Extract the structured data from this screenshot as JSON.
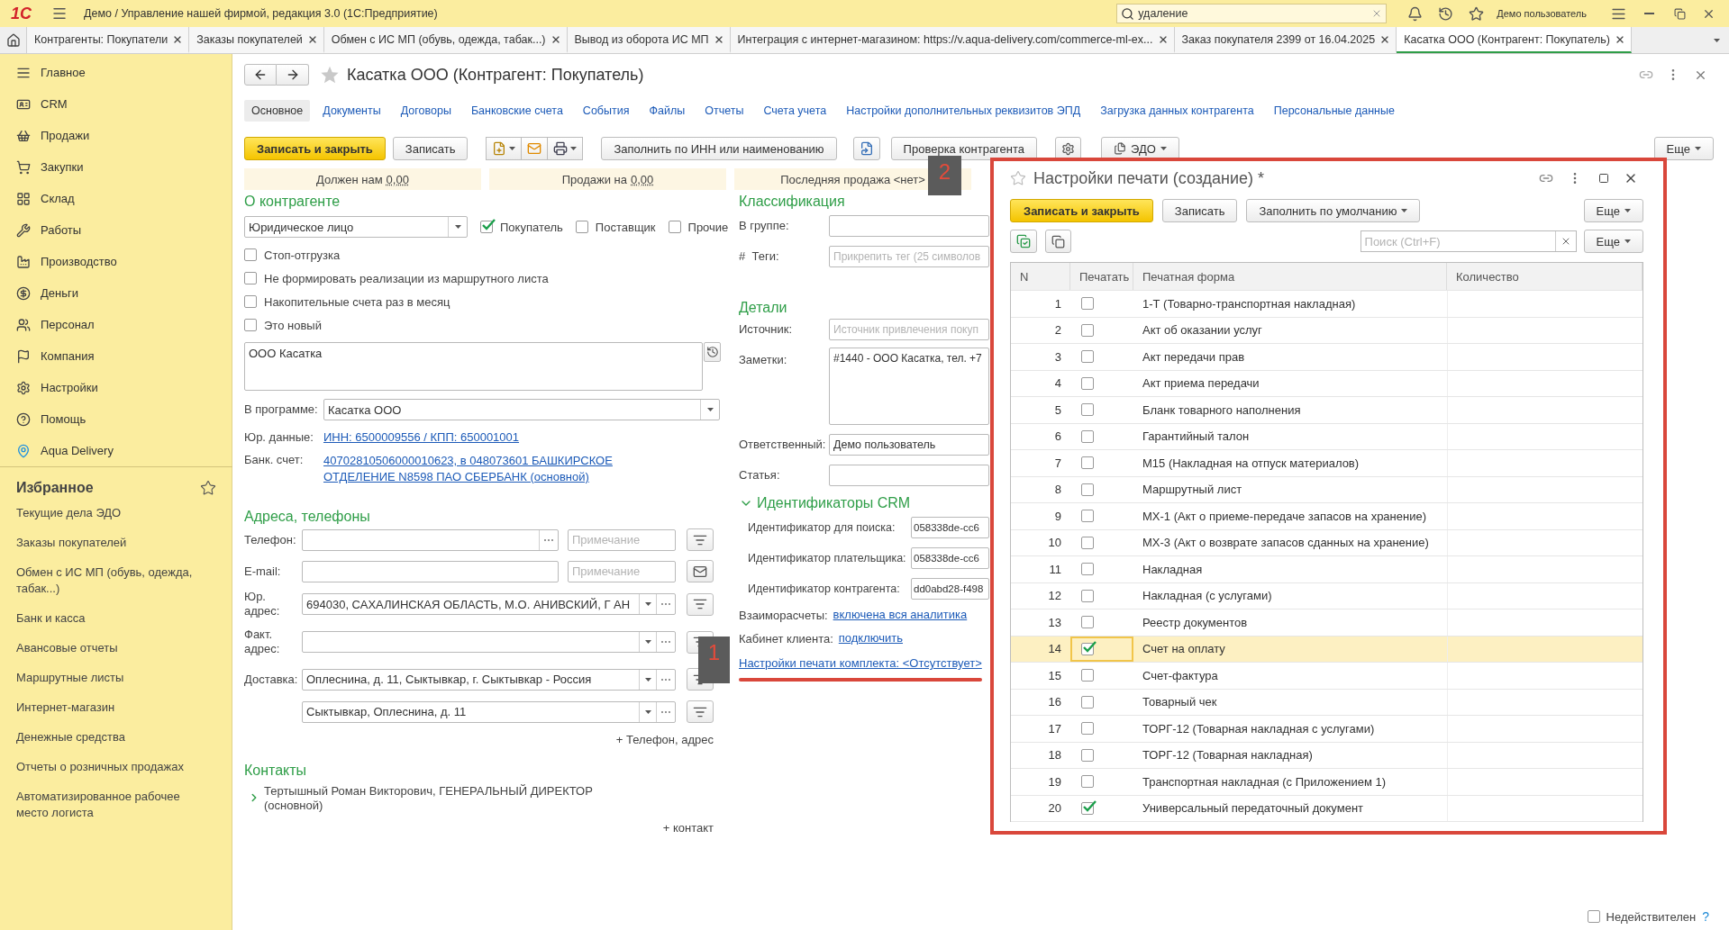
{
  "window": {
    "logo": "1С",
    "title": "Демо / Управление нашей фирмой, редакция 3.0  (1С:Предприятие)",
    "search": {
      "value": "удаление"
    },
    "user": "Демо пользователь"
  },
  "open_tabs": [
    {
      "label": "Контрагенты: Покупатели",
      "selected": false
    },
    {
      "label": "Заказы покупателей",
      "selected": false
    },
    {
      "label": "Обмен с ИС МП (обувь, одежда, табак...)",
      "selected": false
    },
    {
      "label": "Вывод из оборота ИС МП",
      "selected": false
    },
    {
      "label": "Интеграция с интернет-магазином: https://v.aqua-delivery.com/commerce-ml-ex...",
      "selected": false
    },
    {
      "label": "Заказ покупателя 2399 от 16.04.2025",
      "selected": false
    },
    {
      "label": "Касатка ООО (Контрагент: Покупатель)",
      "selected": true
    }
  ],
  "sidebar": {
    "sections": [
      {
        "label": "Главное"
      },
      {
        "label": "CRM"
      },
      {
        "label": "Продажи"
      },
      {
        "label": "Закупки"
      },
      {
        "label": "Склад"
      },
      {
        "label": "Работы"
      },
      {
        "label": "Производство"
      },
      {
        "label": "Деньги"
      },
      {
        "label": "Персонал"
      },
      {
        "label": "Компания"
      },
      {
        "label": "Настройки"
      },
      {
        "label": "Помощь"
      },
      {
        "label": "Aqua Delivery"
      }
    ],
    "favorites_title": "Избранное",
    "favorites": [
      "Текущие дела ЭДО",
      "Заказы покупателей",
      "Обмен с ИС МП (обувь, одежда, табак...)",
      "Банк и касса",
      "Авансовые отчеты",
      "Маршрутные листы",
      "Интернет-магазин",
      "Денежные средства",
      "Отчеты о розничных продажах",
      "Автоматизированное рабочее место логиста"
    ]
  },
  "form": {
    "title": "Касатка ООО (Контрагент: Покупатель)",
    "tabs": [
      {
        "label": "Основное",
        "selected": true
      },
      {
        "label": "Документы",
        "selected": false
      },
      {
        "label": "Договоры",
        "selected": false
      },
      {
        "label": "Банковские счета",
        "selected": false
      },
      {
        "label": "События",
        "selected": false
      },
      {
        "label": "Файлы",
        "selected": false
      },
      {
        "label": "Отчеты",
        "selected": false
      },
      {
        "label": "Счета учета",
        "selected": false
      },
      {
        "label": "Настройки дополнительных реквизитов ЭПД",
        "selected": false
      },
      {
        "label": "Загрузка данных контрагента",
        "selected": false
      },
      {
        "label": "Персональные данные",
        "selected": false
      }
    ],
    "toolbar": {
      "save_close": "Записать и закрыть",
      "save": "Записать",
      "fill": "Заполнить по ИНН или наименованию",
      "check": "Проверка контрагента",
      "edo": "ЭДО",
      "more": "Еще"
    },
    "summary": [
      {
        "label": "Должен нам",
        "value": "0,00"
      },
      {
        "label": "Продажи на",
        "value": "0,00"
      },
      {
        "label": "Последняя продажа <нет>"
      }
    ],
    "about": {
      "heading": "О контрагенте",
      "legal_form": "Юридическое лицо",
      "roles": [
        {
          "label": "Покупатель",
          "checked": true
        },
        {
          "label": "Поставщик",
          "checked": false
        },
        {
          "label": "Прочие",
          "checked": false
        }
      ],
      "options": [
        {
          "label": "Стоп-отгрузка",
          "checked": false
        },
        {
          "label": "Не формировать реализации из маршрутного листа",
          "checked": false
        },
        {
          "label": "Накопительные счета раз в месяц",
          "checked": false
        },
        {
          "label": "Это новый",
          "checked": false
        }
      ],
      "name": "ООО Касатка",
      "program_label": "В программе:",
      "program_name": "Касатка ООО",
      "legal_label": "Юр. данные:",
      "legal_link": "ИНН: 6500009556 / КПП: 650001001",
      "bank_label": "Банк. счет:",
      "bank_link": "40702810506000010623, в 048073601 БАШКИРСКОЕ ОТДЕЛЕНИЕ N8598 ПАО СБЕРБАНК (основной)"
    },
    "addresses": {
      "heading": "Адреса, телефоны",
      "rows": [
        {
          "kind": "phone",
          "label": "Телефон:",
          "note_placeholder": "Примечание"
        },
        {
          "kind": "email",
          "label": "E-mail:",
          "note_placeholder": "Примечание"
        },
        {
          "kind": "address",
          "label": "Юр. адрес:",
          "value": "694030, САХАЛИНСКАЯ ОБЛАСТЬ, М.О. АНИВСКИЙ, Г АН"
        },
        {
          "kind": "address",
          "label": "Факт. адрес:"
        },
        {
          "kind": "address",
          "label": "Доставка:",
          "value": "Оплеснина, д. 11, Сыктывкар, г. Сыктывкар - Россия"
        },
        {
          "kind": "address",
          "value": "Сыктывкар, Оплеснина, д. 11"
        }
      ],
      "add_link": "+ Телефон, адрес"
    },
    "contacts": {
      "heading": "Контакты",
      "items": [
        {
          "name": "Тертышный Роман Викторович, ГЕНЕРАЛЬНЫЙ ДИРЕКТОР (основной)",
          "expanded": false
        }
      ],
      "add_link": "+ контакт"
    },
    "classification": {
      "heading": "Классификация",
      "group_label": "В группе:",
      "tags_label": "#  Теги:",
      "tags_placeholder": "Прикрепить тег (25 символов"
    },
    "details": {
      "heading": "Детали",
      "source_label": "Источник:",
      "source_placeholder": "Источник привлечения покуп",
      "notes_label": "Заметки:",
      "notes": "#1440 - ООО Касатка, тел. +7",
      "manager_label": "Ответственный:",
      "manager": "Демо пользователь",
      "item_label": "Статья:"
    },
    "crm": {
      "heading": "Идентификаторы CRM",
      "expanded": true,
      "ids": [
        {
          "label": "Идентификатор для поиска:",
          "value": "058338de-cc6"
        },
        {
          "label": "Идентификатор плательщика:",
          "value": "058338de-cc6"
        },
        {
          "label": "Идентификатор контрагента:",
          "value": "dd0abd28-f498"
        }
      ]
    },
    "links": [
      {
        "label": "Взаиморасчеты:",
        "link": "включена вся аналитика"
      },
      {
        "label": "Кабинет клиента:",
        "link": "подключить"
      }
    ],
    "print_settings_link": "Настройки печати комплекта: <Отсутствует>",
    "invalid": {
      "label": "Недействителен",
      "checked": false,
      "help": "?"
    }
  },
  "dialog": {
    "title": "Настройки печати (создание) *",
    "save_close": "Записать и закрыть",
    "save": "Записать",
    "fill_default": "Заполнить по умолчанию",
    "more": "Еще",
    "search_placeholder": "Поиск (Ctrl+F)",
    "more_table": "Еще",
    "columns": [
      "N",
      "Печатать",
      "Печатная форма",
      "Количество"
    ],
    "rows": [
      {
        "n": "1",
        "name": "1-Т (Товарно-транспортная накладная)",
        "checked": false,
        "selected": false
      },
      {
        "n": "2",
        "name": "Акт об оказании услуг",
        "checked": false,
        "selected": false
      },
      {
        "n": "3",
        "name": "Акт передачи прав",
        "checked": false,
        "selected": false
      },
      {
        "n": "4",
        "name": "Акт приема передачи",
        "checked": false,
        "selected": false
      },
      {
        "n": "5",
        "name": "Бланк товарного наполнения",
        "checked": false,
        "selected": false
      },
      {
        "n": "6",
        "name": "Гарантийный талон",
        "checked": false,
        "selected": false
      },
      {
        "n": "7",
        "name": "М15 (Накладная на отпуск материалов)",
        "checked": false,
        "selected": false
      },
      {
        "n": "8",
        "name": "Маршрутный лист",
        "checked": false,
        "selected": false
      },
      {
        "n": "9",
        "name": "МХ-1 (Акт о приеме-передаче запасов на хранение)",
        "checked": false,
        "selected": false
      },
      {
        "n": "10",
        "name": "МХ-3 (Акт о возврате запасов сданных на хранение)",
        "checked": false,
        "selected": false
      },
      {
        "n": "11",
        "name": "Накладная",
        "checked": false,
        "selected": false
      },
      {
        "n": "12",
        "name": "Накладная (с услугами)",
        "checked": false,
        "selected": false
      },
      {
        "n": "13",
        "name": "Реестр документов",
        "checked": false,
        "selected": false
      },
      {
        "n": "14",
        "name": "Счет на оплату",
        "checked": true,
        "selected": true
      },
      {
        "n": "15",
        "name": "Счет-фактура",
        "checked": false,
        "selected": false
      },
      {
        "n": "16",
        "name": "Товарный чек",
        "checked": false,
        "selected": false
      },
      {
        "n": "17",
        "name": "ТОРГ-12 (Товарная накладная с услугами)",
        "checked": false,
        "selected": false
      },
      {
        "n": "18",
        "name": "ТОРГ-12 (Товарная накладная)",
        "checked": false,
        "selected": false
      },
      {
        "n": "19",
        "name": "Транспортная накладная (с Приложением 1)",
        "checked": false,
        "selected": false
      },
      {
        "n": "20",
        "name": "Универсальный передаточный документ",
        "checked": true,
        "selected": false
      }
    ]
  },
  "annotations": [
    {
      "label": "1"
    },
    {
      "label": "2"
    }
  ]
}
